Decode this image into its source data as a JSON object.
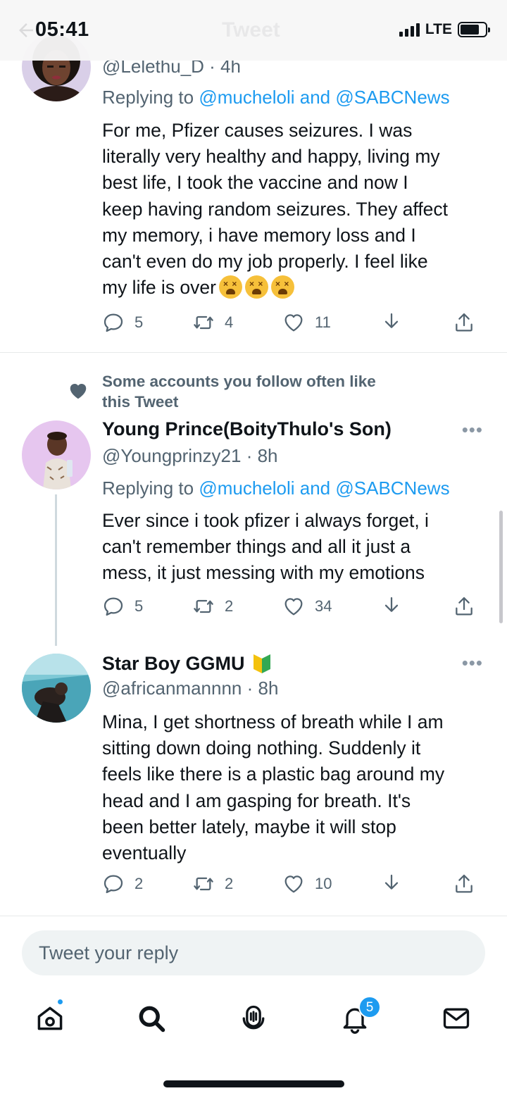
{
  "status_bar": {
    "time": "05:41",
    "network": "LTE",
    "ghost_title": "Tweet"
  },
  "tweets": [
    {
      "handle": "@Lelethu_D",
      "time": "4h",
      "replying_prefix": "Replying to ",
      "replying_to": "@mucheloli and @SABCNews",
      "body": "For me, Pfizer causes seizures. I was\nliterally very healthy and happy, living my\nbest life, I took the vaccine and now I\nkeep having random seizures. They affect\nmy memory, i have memory loss and I\ncan't even do my job properly. I feel like\nmy life is over",
      "emoji": "tired-face x3",
      "replies": "5",
      "retweets": "4",
      "likes": "11"
    },
    {
      "social_context": "Some accounts you follow often like\nthis Tweet",
      "name": "Young Prince(BoityThulo's Son)",
      "handle": "@Youngprinzy21",
      "time": "8h",
      "replying_prefix": "Replying to ",
      "replying_to": "@mucheloli and @SABCNews",
      "body": "Ever since i took pfizer i always forget, i\ncan't remember things and all it just a\nmess, it just messing with my emotions",
      "replies": "5",
      "retweets": "2",
      "likes": "34"
    },
    {
      "name": "Star Boy GGMU",
      "handle": "@africanmannnn",
      "time": "8h",
      "body": "Mina, I get shortness of breath while I am\nsitting down doing nothing.  Suddenly it\nfeels like there is a plastic bag around my\nhead and I am gasping for breath.  It's\nbeen better lately,  maybe it will stop\neventually",
      "replies": "2",
      "retweets": "2",
      "likes": "10"
    }
  ],
  "more_label": "•••",
  "separator": " · ",
  "reply_box": {
    "placeholder": "Tweet your reply"
  },
  "tab_bar": {
    "items": [
      "home-icon",
      "search-icon",
      "spaces-icon",
      "notifications-icon",
      "messages-icon"
    ],
    "notifications_count": "5"
  },
  "colors": {
    "accent": "#1d9bf0",
    "secondary_text": "#536471"
  }
}
